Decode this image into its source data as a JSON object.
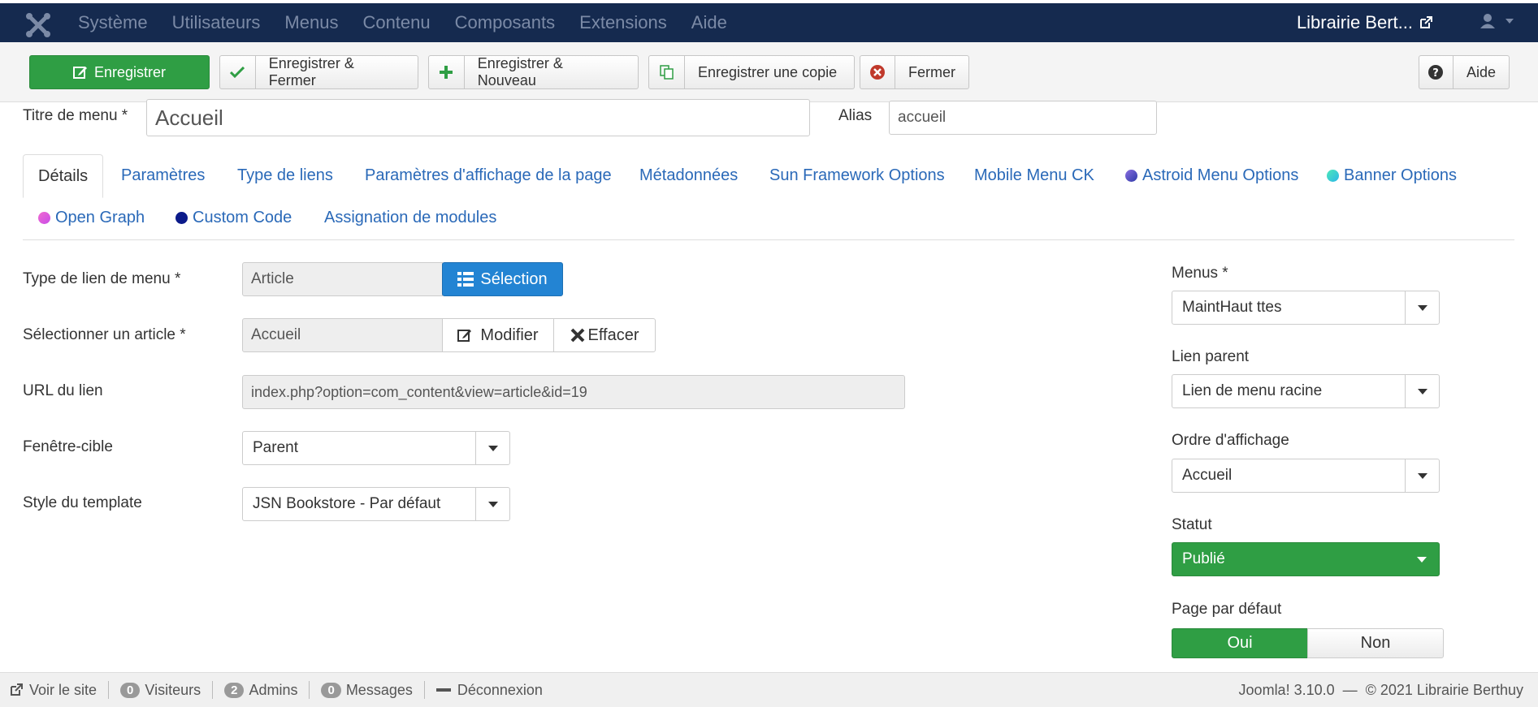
{
  "topbar": {
    "menu": [
      "Système",
      "Utilisateurs",
      "Menus",
      "Contenu",
      "Composants",
      "Extensions",
      "Aide"
    ],
    "site_name": "Librairie Bert..."
  },
  "toolbar": {
    "save": "Enregistrer",
    "save_close": "Enregistrer & Fermer",
    "save_new": "Enregistrer & Nouveau",
    "save_copy": "Enregistrer une copie",
    "close": "Fermer",
    "help": "Aide"
  },
  "title_row": {
    "title_label": "Titre de menu *",
    "title_value": "Accueil",
    "alias_label": "Alias",
    "alias_value": "accueil"
  },
  "tabs": [
    {
      "label": "Détails",
      "active": true
    },
    {
      "label": "Paramètres"
    },
    {
      "label": "Type de liens"
    },
    {
      "label": "Paramètres d'affichage de la page"
    },
    {
      "label": "Métadonnées"
    },
    {
      "label": "Sun Framework Options"
    },
    {
      "label": "Mobile Menu CK"
    },
    {
      "label": "Astroid Menu Options",
      "dot": "#6a5acd"
    },
    {
      "label": "Banner Options",
      "dot": "#3dd6c0"
    },
    {
      "label": "Open Graph",
      "dot": "#e64bc6"
    },
    {
      "label": "Custom Code",
      "dot": "#0b1a8a"
    },
    {
      "label": "Assignation de modules"
    }
  ],
  "form": {
    "link_type_label": "Type de lien de menu *",
    "link_type_value": "Article",
    "select_btn": "Sélection",
    "article_label": "Sélectionner un article *",
    "article_value": "Accueil",
    "edit_btn": "Modifier",
    "clear_btn": "Effacer",
    "url_label": "URL du lien",
    "url_value": "index.php?option=com_content&view=article&id=19",
    "target_label": "Fenêtre-cible",
    "target_value": "Parent",
    "template_label": "Style du template",
    "template_value": "JSN Bookstore - Par défaut"
  },
  "sidebar": {
    "menus_label": "Menus *",
    "menus_value": "MaintHaut ttes",
    "parent_label": "Lien parent",
    "parent_value": "Lien de menu racine",
    "order_label": "Ordre d'affichage",
    "order_value": "Accueil",
    "status_label": "Statut",
    "status_value": "Publié",
    "default_label": "Page par défaut",
    "yes": "Oui",
    "no": "Non"
  },
  "footer": {
    "view_site": "Voir le site",
    "visitors_count": "0",
    "visitors": "Visiteurs",
    "admins_count": "2",
    "admins": "Admins",
    "messages_count": "0",
    "messages": "Messages",
    "logout": "Déconnexion",
    "version": "Joomla! 3.10.0",
    "copyright": "© 2021 Librairie Berthuy"
  },
  "colors": {
    "navbar": "#152a4f",
    "primary": "#2a69b8",
    "success": "#2f9e44",
    "select_btn": "#2384d3"
  }
}
